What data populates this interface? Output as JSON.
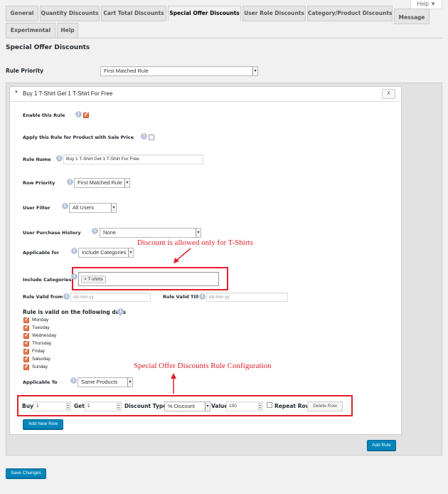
{
  "help_tab": "Help ▼",
  "tabs": [
    "General",
    "Quantity Discounts",
    "Cart Total Discounts",
    "Special Offer Discounts",
    "User Role Discounts",
    "Category/Product Discounts",
    "Message",
    "Experimental",
    "Help"
  ],
  "active_tab": "Special Offer Discounts",
  "page_title": "Special Offer Discounts",
  "rule_priority": {
    "label": "Rule Priority",
    "value": "First Matched Rule"
  },
  "rule": {
    "title": "Buy 1 T-Shirt Get 1 T-Shirt For Free",
    "close_label": "X",
    "enable_label": "Enable this Rule",
    "sale_price_label": "Apply this Rule for Product with Sale Price",
    "rule_name_label": "Rule Name",
    "rule_name_value": "Buy 1 T-Shirt Get 1 T-Shirt For Free",
    "row_priority_label": "Row Priority",
    "row_priority_value": "First Matched Rule",
    "user_filter_label": "User Filter",
    "user_filter_value": "All Users",
    "purchase_history_label": "User Purchase History",
    "purchase_history_value": "None",
    "applicable_for_label": "Applicable for",
    "applicable_for_value": "Include Categories",
    "include_categories_label": "Include Categories",
    "category_tag": "× T-shirts",
    "valid_from_label": "Rule Valid from",
    "valid_from_placeholder": "dd-mm-yy",
    "valid_till_label": "Rule Valid Till",
    "valid_till_placeholder": "dd-mm-yy",
    "days_label": "Rule is valid on the following days",
    "days": [
      "Monday",
      "Tuesday",
      "Wednesday",
      "Thursday",
      "Friday",
      "Saturday",
      "Sunday"
    ],
    "applicable_to_label": "Applicable To",
    "applicable_to_value": "Same Products",
    "row": {
      "buy_label": "Buy",
      "buy_value": "1",
      "get_label": "Get",
      "get_value": "1",
      "discount_type_label": "Discount Type",
      "discount_type_value": "% Discount",
      "value_label": "Value",
      "value_value": "100",
      "repeat_label": "Repeat Row",
      "delete_label": "Delete Row"
    },
    "add_row_label": "Add New Row"
  },
  "annotations": {
    "categories_note": "Discount is allowed only for T-Shirts",
    "config_note": "Special Offer Discounts Rule Configuration"
  },
  "add_rule_label": "Add Rule",
  "save_label": "Save Changes",
  "colors": {
    "accent": "#0085ba",
    "annotation": "#e0202b",
    "checkbox": "#e47a4d"
  }
}
